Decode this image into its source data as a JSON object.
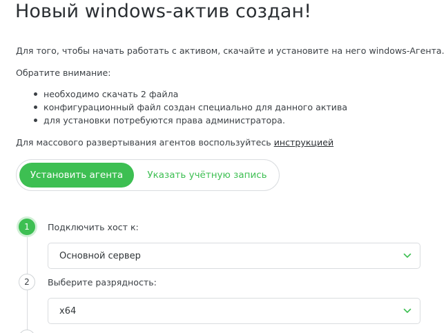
{
  "page": {
    "title": "Новый windows-актив создан!",
    "intro": "Для того, чтобы начать работать с активом, скачайте и установите на него windows-Агента.",
    "notice": "Обратите внимание:",
    "bullets": [
      "необходимо скачать 2 файла",
      "конфигурационный файл создан специально для данного актива",
      "для установки потребуются права администратора."
    ],
    "mass_prefix": "Для массового развертывания агентов воспользуйтесь ",
    "mass_link": "инструкцией"
  },
  "toggle": {
    "active": "Установить агента",
    "inactive": "Указать учётную запись"
  },
  "steps": [
    {
      "number": "1",
      "label": "Подключить хост к:",
      "value": "Основной сервер"
    },
    {
      "number": "2",
      "label": "Выберите разрядность:",
      "value": "x64"
    }
  ],
  "colors": {
    "accent": "#3dbf52",
    "text": "#3a3f44",
    "border": "#d9dcdf"
  },
  "icons": {
    "select_arrow": "chevron-down-icon"
  }
}
